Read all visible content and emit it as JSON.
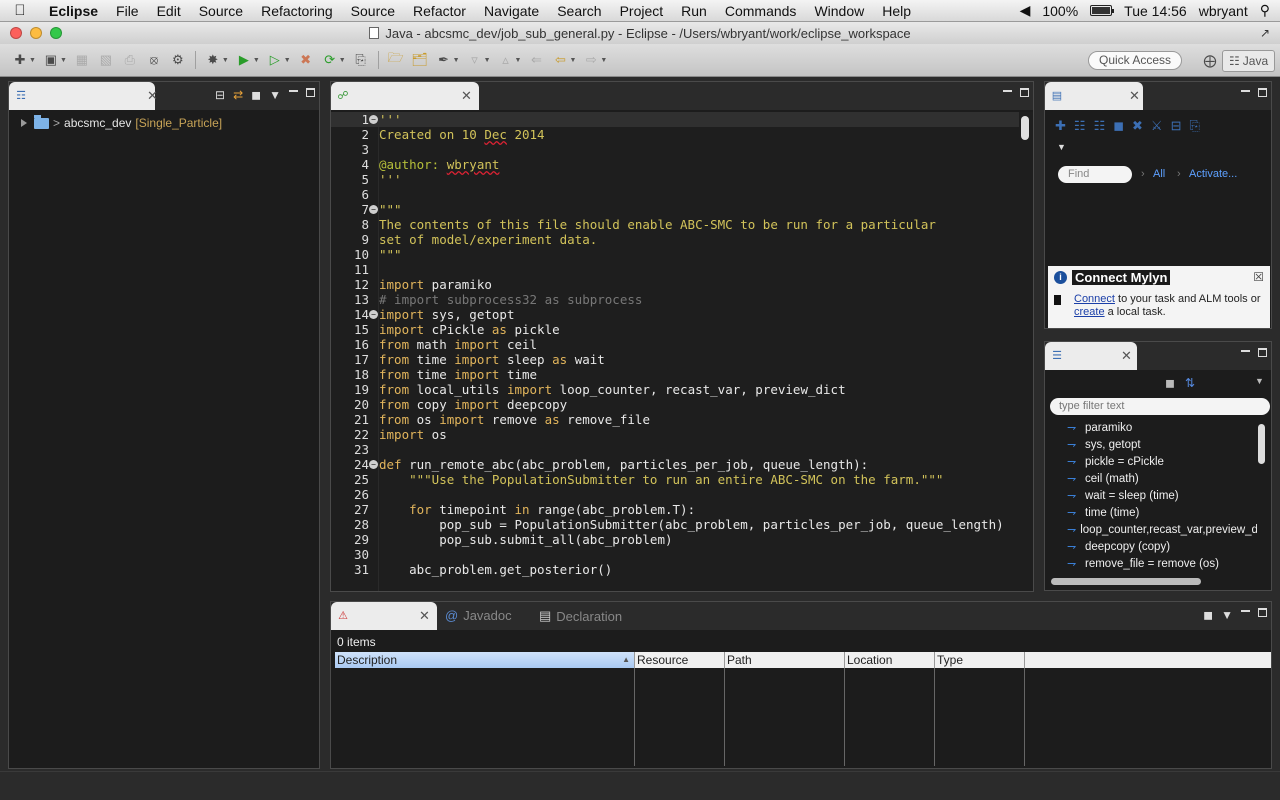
{
  "menubar": {
    "app": "Eclipse",
    "items": [
      "File",
      "Edit",
      "Source",
      "Refactoring",
      "Source",
      "Refactor",
      "Navigate",
      "Search",
      "Project",
      "Run",
      "Commands",
      "Window",
      "Help"
    ],
    "battery": "100%",
    "clock": "Tue 14:56",
    "user": "wbryant"
  },
  "window": {
    "title": "Java - abcsmc_dev/job_sub_general.py - Eclipse - /Users/wbryant/work/eclipse_workspace"
  },
  "toolbar": {
    "quick_access": "Quick Access",
    "perspective": "Java"
  },
  "explorer": {
    "project_name": "abcsmc_dev",
    "project_branch": "[Single_Particle]"
  },
  "editor": {
    "lines": [
      {
        "n": "1",
        "fold": true,
        "text": "'''"
      },
      {
        "n": "2",
        "text": "Created on 10 Dec 2014"
      },
      {
        "n": "3",
        "text": ""
      },
      {
        "n": "4",
        "text": "@author: wbryant"
      },
      {
        "n": "5",
        "text": "'''"
      },
      {
        "n": "6",
        "text": ""
      },
      {
        "n": "7",
        "fold": true,
        "text": "\"\"\""
      },
      {
        "n": "8",
        "text": "The contents of this file should enable ABC-SMC to be run for a particular"
      },
      {
        "n": "9",
        "text": "set of model/experiment data."
      },
      {
        "n": "10",
        "text": "\"\"\""
      },
      {
        "n": "11",
        "text": ""
      },
      {
        "n": "12",
        "text": "import paramiko"
      },
      {
        "n": "13",
        "text": "# import subprocess32 as subprocess"
      },
      {
        "n": "14",
        "fold": true,
        "text": "import sys, getopt"
      },
      {
        "n": "15",
        "text": "import cPickle as pickle"
      },
      {
        "n": "16",
        "text": "from math import ceil"
      },
      {
        "n": "17",
        "text": "from time import sleep as wait"
      },
      {
        "n": "18",
        "text": "from time import time"
      },
      {
        "n": "19",
        "text": "from local_utils import loop_counter, recast_var, preview_dict"
      },
      {
        "n": "20",
        "text": "from copy import deepcopy"
      },
      {
        "n": "21",
        "text": "from os import remove as remove_file"
      },
      {
        "n": "22",
        "text": "import os"
      },
      {
        "n": "23",
        "text": ""
      },
      {
        "n": "24",
        "fold": true,
        "text": "def run_remote_abc(abc_problem, particles_per_job, queue_length):"
      },
      {
        "n": "25",
        "text": "    \"\"\"Use the PopulationSubmitter to run an entire ABC-SMC on the farm.\"\"\""
      },
      {
        "n": "26",
        "text": ""
      },
      {
        "n": "27",
        "text": "    for timepoint in range(abc_problem.T):"
      },
      {
        "n": "28",
        "text": "        pop_sub = PopulationSubmitter(abc_problem, particles_per_job, queue_length)"
      },
      {
        "n": "29",
        "text": "        pop_sub.submit_all(abc_problem)"
      },
      {
        "n": "30",
        "text": ""
      },
      {
        "n": "31",
        "text": "    abc_problem.get_posterior()"
      }
    ]
  },
  "tasks": {
    "find_placeholder": "Find",
    "all_label": "All",
    "activate_label": "Activate...",
    "mylyn": {
      "title": "Connect Mylyn",
      "connect_link": "Connect",
      "text1": " to your task and ALM tools or ",
      "create_link": "create",
      "text2": " a local task."
    }
  },
  "outline": {
    "filter_placeholder": "type filter text",
    "items": [
      "paramiko",
      "sys, getopt",
      "pickle = cPickle",
      "ceil (math)",
      "wait = sleep (time)",
      "time (time)",
      "loop_counter,recast_var,preview_dict",
      "deepcopy (copy)",
      "remove_file = remove (os)"
    ]
  },
  "problems": {
    "tabs": [
      "Javadoc",
      "Declaration"
    ],
    "count": "0 items",
    "columns": [
      "Description",
      "Resource",
      "Path",
      "Location",
      "Type"
    ]
  }
}
